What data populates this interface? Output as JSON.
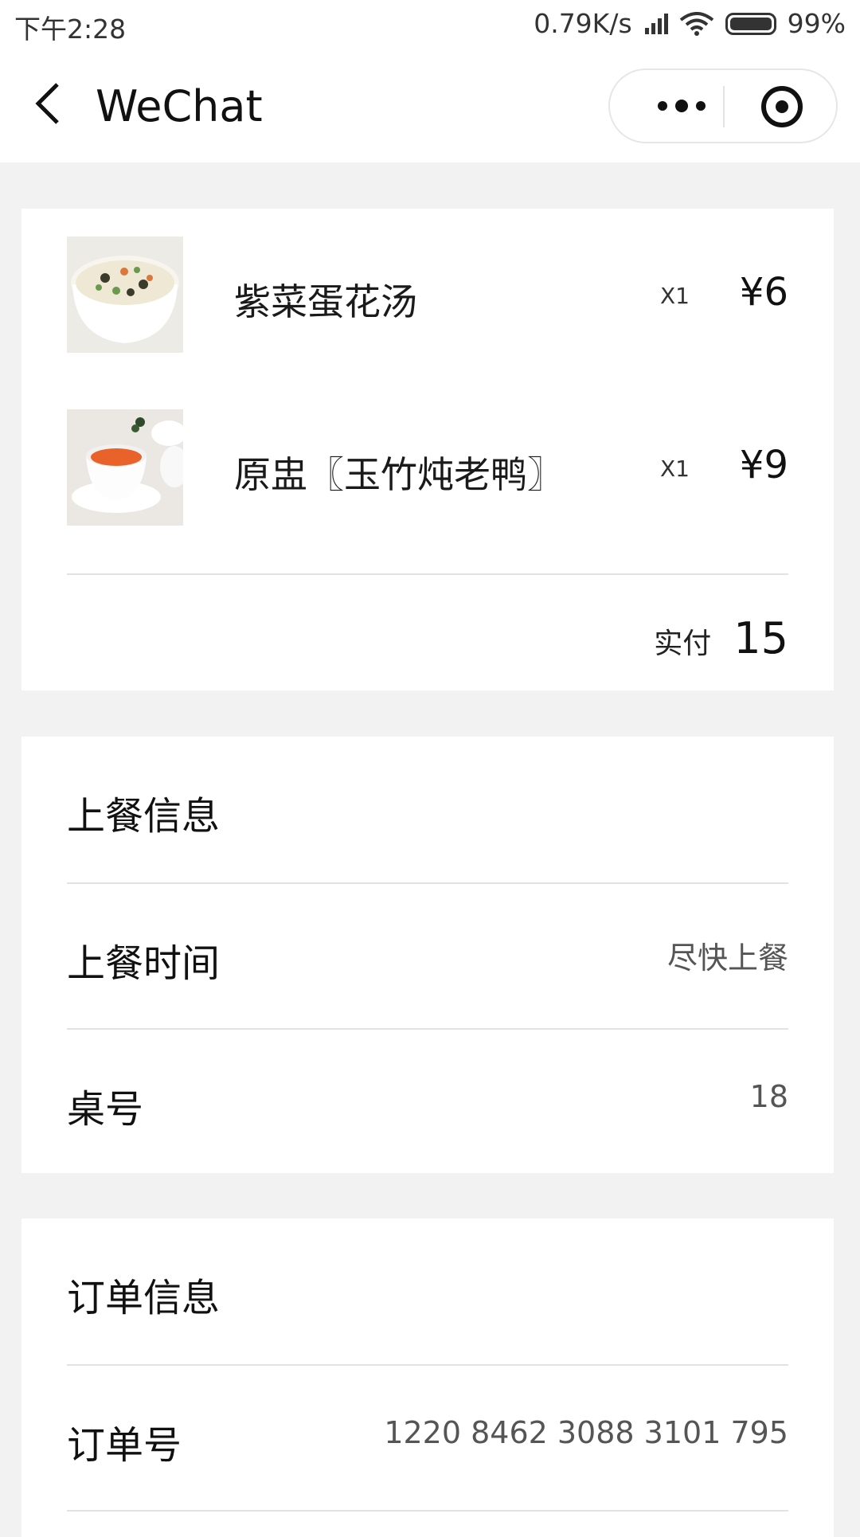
{
  "status_bar": {
    "time": "下午2:28",
    "speed": "0.79K/s",
    "battery": "99%"
  },
  "nav": {
    "title": "WeChat"
  },
  "order_items": [
    {
      "name": "紫菜蛋花汤",
      "qty": "X1",
      "price": "¥6"
    },
    {
      "name": "原盅〖玉竹炖老鸭〗",
      "qty": "X1",
      "price": "¥9"
    }
  ],
  "total": {
    "label": "实付",
    "value": "15"
  },
  "serving": {
    "title": "上餐信息",
    "time_label": "上餐时间",
    "time_value": "尽快上餐",
    "table_label": "桌号",
    "table_value": "18"
  },
  "order_info": {
    "title": "订单信息",
    "order_no_label": "订单号",
    "order_no_value": "1220 8462 3088 3101 795"
  },
  "colors": {
    "background": "#f2f2f2",
    "card": "#ffffff",
    "divider": "#e2e2e2"
  }
}
